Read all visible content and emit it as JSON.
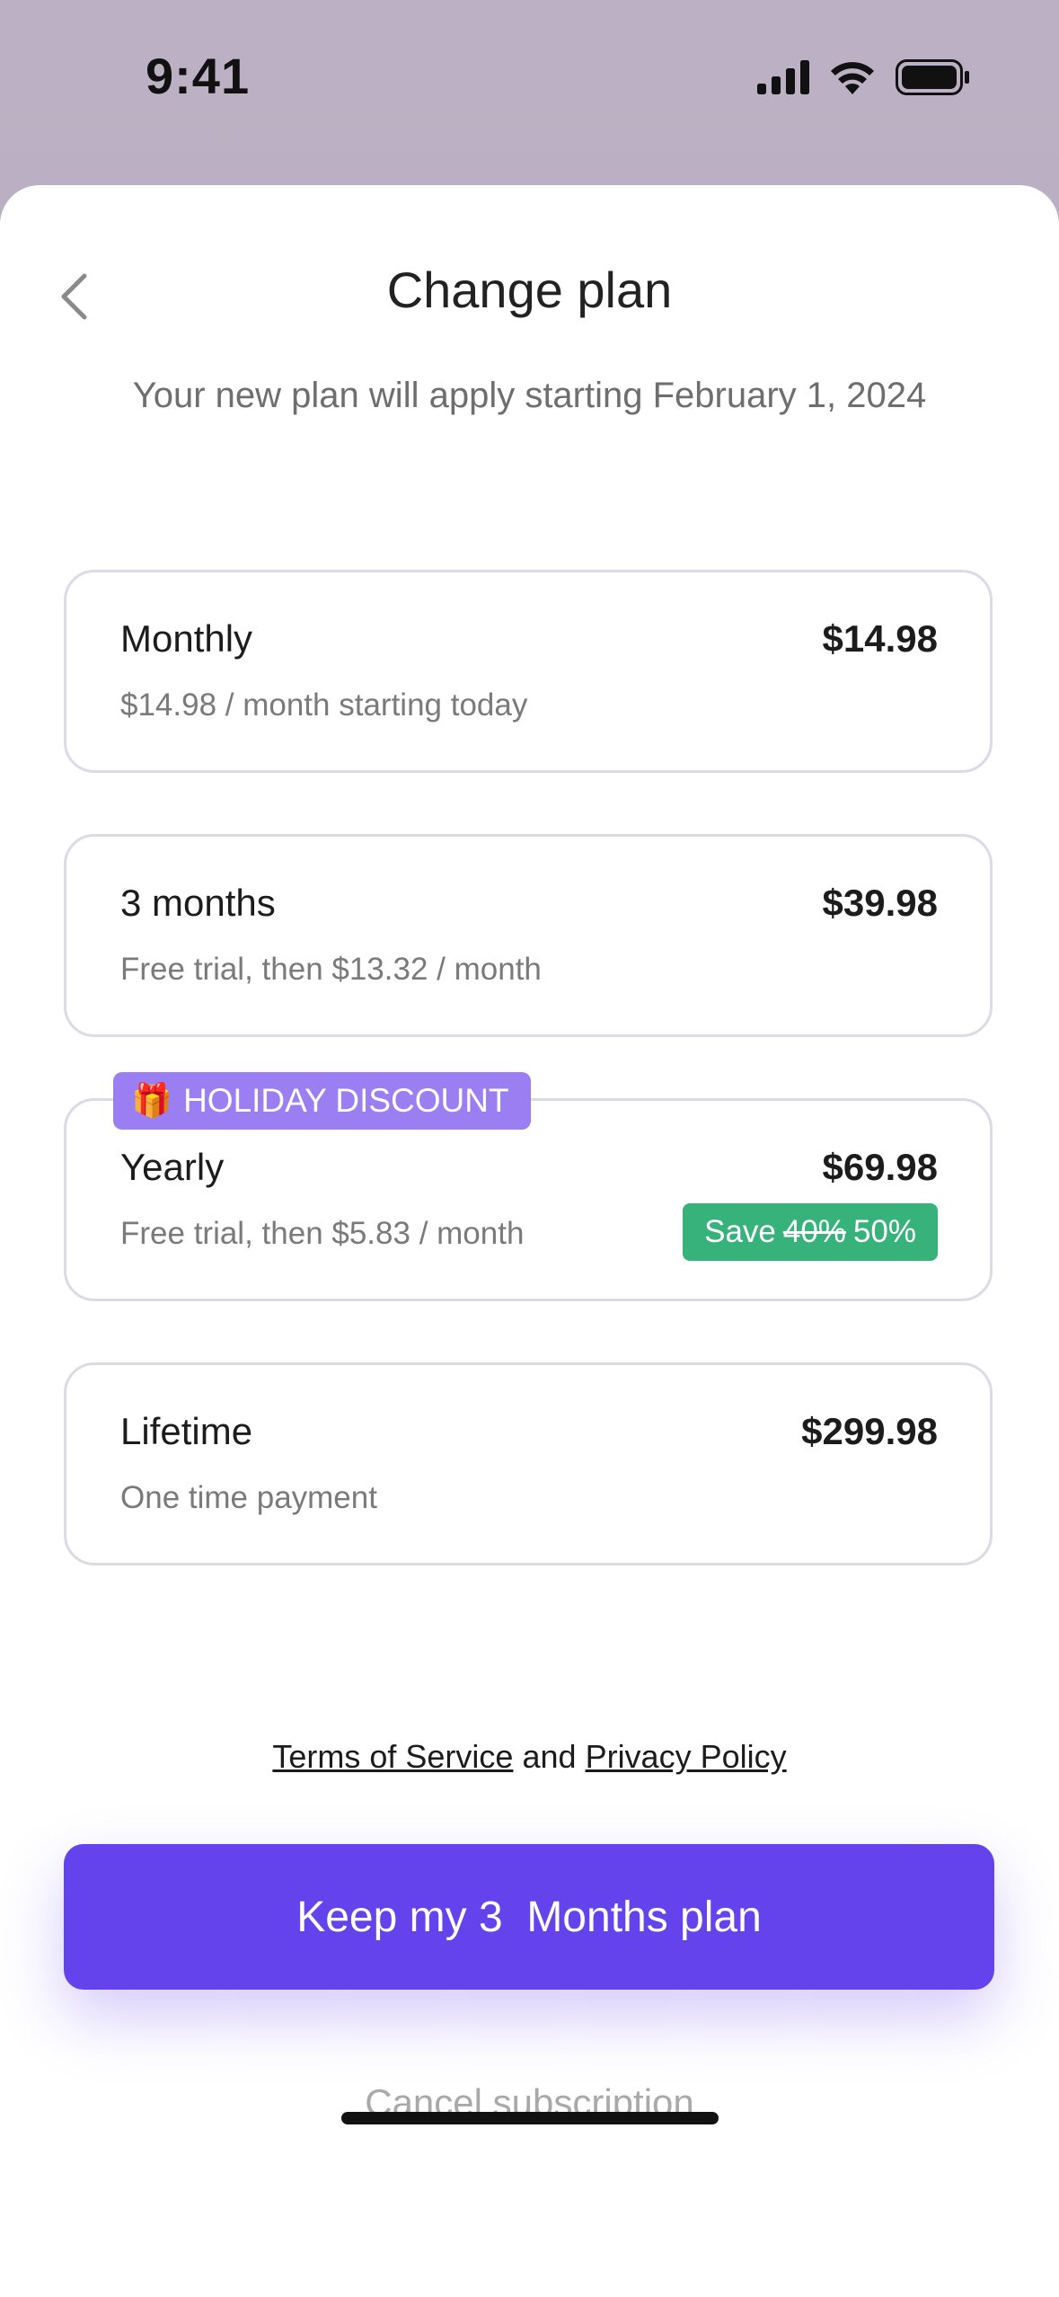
{
  "status_bar": {
    "time": "9:41"
  },
  "header": {
    "title": "Change plan",
    "subtitle": "Your new plan will apply starting February 1, 2024"
  },
  "plans": [
    {
      "name": "Monthly",
      "price": "$14.98",
      "description": "$14.98 / month starting today"
    },
    {
      "name": "3 months",
      "price": "$39.98",
      "description": "Free trial, then $13.32 / month"
    },
    {
      "name": "Yearly",
      "price": "$69.98",
      "description": "Free trial, then $5.83 / month",
      "badge": {
        "emoji": "🎁",
        "text": "HOLIDAY DISCOUNT"
      },
      "save": {
        "label": "Save",
        "old": "40%",
        "new": "50%"
      }
    },
    {
      "name": "Lifetime",
      "price": "$299.98",
      "description": "One time payment"
    }
  ],
  "legal": {
    "terms": "Terms of Service",
    "and": "and",
    "privacy": "Privacy Policy"
  },
  "actions": {
    "keep_label": "Keep my 3  Months plan",
    "cancel_label": "Cancel subscription"
  },
  "colors": {
    "accent": "#6442ec",
    "badge_purple": "#9b7ff2",
    "save_green": "#37b27a",
    "card_border": "#dadbe6"
  },
  "icons": {
    "back": "chevron-left-icon",
    "signal": "cellular-signal-icon",
    "wifi": "wifi-icon",
    "battery": "battery-icon"
  }
}
